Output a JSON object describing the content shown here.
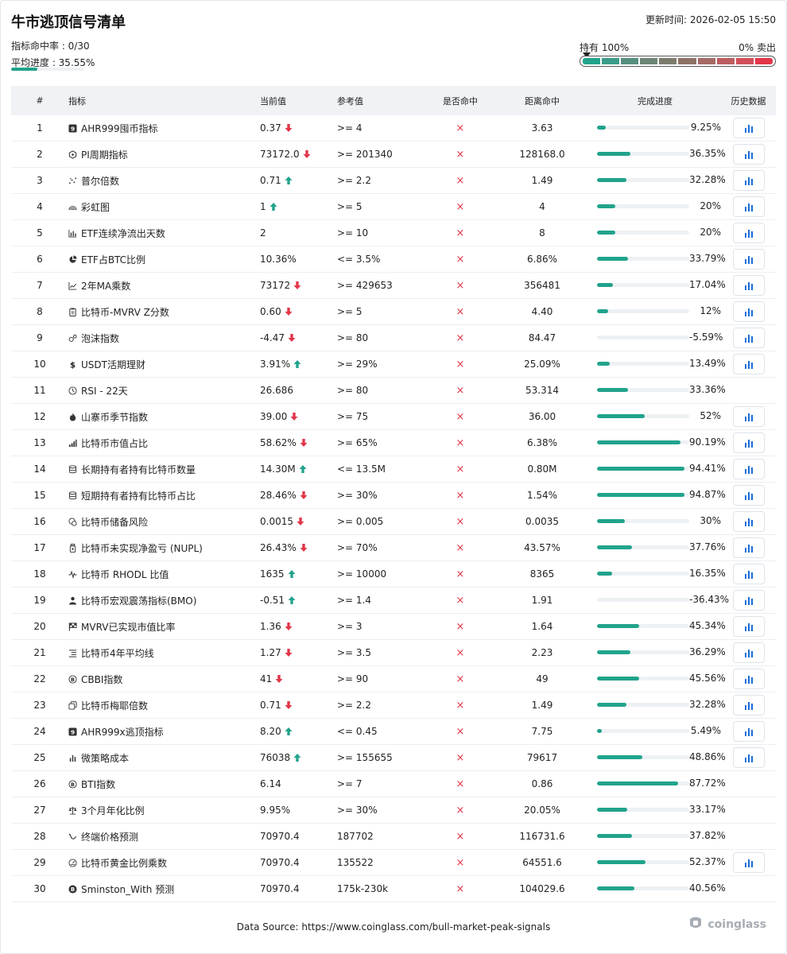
{
  "header": {
    "title": "牛市逃顶信号清单",
    "updated": "更新时间: 2026-02-05 15:50",
    "hit_rate": "指标命中率 : 0/30",
    "avg_progress_label": "平均进度 : 35.55%",
    "avg_progress_value": 35.55
  },
  "scale": {
    "left_label": "持有 100%",
    "right_label": "0% 卖出",
    "segments": [
      "#21a38c",
      "#3b9c8a",
      "#568f80",
      "#6b8576",
      "#7d7b6d",
      "#8f7266",
      "#a56a65",
      "#bb5d60",
      "#d24f5a",
      "#e2364a"
    ]
  },
  "colors": {
    "accent": "#21a38c",
    "down": "#e2364a",
    "up": "#21a38c",
    "chart_btn": "#1a6ed8"
  },
  "columns": {
    "idx": "#",
    "name": "指标",
    "current": "当前值",
    "reference": "参考值",
    "hit": "是否命中",
    "distance": "距离命中",
    "progress": "完成进度",
    "history": "历史数据"
  },
  "hit_symbol": "×",
  "rows": [
    {
      "idx": "1",
      "icon": "nine-badge-icon",
      "name": "AHR999囤币指标",
      "current": "0.37",
      "trend": "down",
      "reference": ">= 4",
      "distance": "3.63",
      "progress": 9.25,
      "progress_label": "9.25%",
      "history": true
    },
    {
      "idx": "2",
      "icon": "pi-cycle-icon",
      "name": "PI周期指标",
      "current": "73172.0",
      "trend": "down",
      "reference": ">= 201340",
      "distance": "128168.0",
      "progress": 36.35,
      "progress_label": "36.35%",
      "history": true
    },
    {
      "idx": "3",
      "icon": "scatter-icon",
      "name": "普尔倍数",
      "current": "0.71",
      "trend": "up",
      "reference": ">= 2.2",
      "distance": "1.49",
      "progress": 32.28,
      "progress_label": "32.28%",
      "history": true
    },
    {
      "idx": "4",
      "icon": "rainbow-icon",
      "name": "彩虹图",
      "current": "1",
      "trend": "up",
      "reference": ">= 5",
      "distance": "4",
      "progress": 20,
      "progress_label": "20%",
      "history": true
    },
    {
      "idx": "5",
      "icon": "bar-chart-icon",
      "name": "ETF连续净流出天数",
      "current": "2",
      "trend": "",
      "reference": ">= 10",
      "distance": "8",
      "progress": 20,
      "progress_label": "20%",
      "history": true
    },
    {
      "idx": "6",
      "icon": "pie-chart-icon",
      "name": "ETF占BTC比例",
      "current": "10.36%",
      "trend": "",
      "reference": "<= 3.5%",
      "distance": "6.86%",
      "progress": 33.79,
      "progress_label": "33.79%",
      "history": true
    },
    {
      "idx": "7",
      "icon": "line-chart-icon",
      "name": "2年MA乘数",
      "current": "73172",
      "trend": "down",
      "reference": ">= 429653",
      "distance": "356481",
      "progress": 17.04,
      "progress_label": "17.04%",
      "history": true
    },
    {
      "idx": "8",
      "icon": "clipboard-icon",
      "name": "比特币-MVRV Z分数",
      "current": "0.60",
      "trend": "down",
      "reference": ">= 5",
      "distance": "4.40",
      "progress": 12,
      "progress_label": "12%",
      "history": true
    },
    {
      "idx": "9",
      "icon": "bubbles-icon",
      "name": "泡沫指数",
      "current": "-4.47",
      "trend": "down",
      "reference": ">= 80",
      "distance": "84.47",
      "progress": 0,
      "progress_label": "-5.59%",
      "history": true
    },
    {
      "idx": "10",
      "icon": "dollar-icon",
      "name": "USDT活期理财",
      "current": "3.91%",
      "trend": "up",
      "reference": ">= 29%",
      "distance": "25.09%",
      "progress": 13.49,
      "progress_label": "13.49%",
      "history": true
    },
    {
      "idx": "11",
      "icon": "clock-icon",
      "name": "RSI - 22天",
      "current": "26.686",
      "trend": "",
      "reference": ">= 80",
      "distance": "53.314",
      "progress": 33.36,
      "progress_label": "33.36%",
      "history": false
    },
    {
      "idx": "12",
      "icon": "fire-icon",
      "name": "山寨币季节指数",
      "current": "39.00",
      "trend": "down",
      "reference": ">= 75",
      "distance": "36.00",
      "progress": 52,
      "progress_label": "52%",
      "history": true
    },
    {
      "idx": "13",
      "icon": "signal-bars-icon",
      "name": "比特币市值占比",
      "current": "58.62%",
      "trend": "down",
      "reference": ">= 65%",
      "distance": "6.38%",
      "progress": 90.19,
      "progress_label": "90.19%",
      "history": true
    },
    {
      "idx": "14",
      "icon": "database-icon",
      "name": "长期持有者持有比特币数量",
      "current": "14.30M",
      "trend": "up",
      "reference": "<= 13.5M",
      "distance": "0.80M",
      "progress": 94.41,
      "progress_label": "94.41%",
      "history": true
    },
    {
      "idx": "15",
      "icon": "database-icon",
      "name": "短期持有者持有比特币占比",
      "current": "28.46%",
      "trend": "down",
      "reference": ">= 30%",
      "distance": "1.54%",
      "progress": 94.87,
      "progress_label": "94.87%",
      "history": true
    },
    {
      "idx": "16",
      "icon": "reserve-icon",
      "name": "比特币储备风险",
      "current": "0.0015",
      "trend": "down",
      "reference": ">= 0.005",
      "distance": "0.0035",
      "progress": 30,
      "progress_label": "30%",
      "history": true
    },
    {
      "idx": "17",
      "icon": "jar-icon",
      "name": "比特币未实现净盈亏 (NUPL)",
      "current": "26.43%",
      "trend": "down",
      "reference": ">= 70%",
      "distance": "43.57%",
      "progress": 37.76,
      "progress_label": "37.76%",
      "history": true
    },
    {
      "idx": "18",
      "icon": "pulse-icon",
      "name": "比特币 RHODL 比值",
      "current": "1635",
      "trend": "up",
      "reference": ">= 10000",
      "distance": "8365",
      "progress": 16.35,
      "progress_label": "16.35%",
      "history": true
    },
    {
      "idx": "19",
      "icon": "person-icon",
      "name": "比特币宏观震荡指标(BMO)",
      "current": "-0.51",
      "trend": "up",
      "reference": ">= 1.4",
      "distance": "1.91",
      "progress": 0,
      "progress_label": "-36.43%",
      "history": true
    },
    {
      "idx": "20",
      "icon": "flag-icon",
      "name": "MVRV已实现市值比率",
      "current": "1.36",
      "trend": "down",
      "reference": ">= 3",
      "distance": "1.64",
      "progress": 45.34,
      "progress_label": "45.34%",
      "history": true
    },
    {
      "idx": "21",
      "icon": "list-icon",
      "name": "比特币4年平均线",
      "current": "1.27",
      "trend": "down",
      "reference": ">= 3.5",
      "distance": "2.23",
      "progress": 36.29,
      "progress_label": "36.29%",
      "history": true
    },
    {
      "idx": "22",
      "icon": "bitcoin-outline-icon",
      "name": "CBBI指数",
      "current": "41",
      "trend": "down",
      "reference": ">= 90",
      "distance": "49",
      "progress": 45.56,
      "progress_label": "45.56%",
      "history": true
    },
    {
      "idx": "23",
      "icon": "copy-icon",
      "name": "比特币梅耶倍数",
      "current": "0.71",
      "trend": "down",
      "reference": ">= 2.2",
      "distance": "1.49",
      "progress": 32.28,
      "progress_label": "32.28%",
      "history": true
    },
    {
      "idx": "24",
      "icon": "nine-badge-icon",
      "name": "AHR999x逃顶指标",
      "current": "8.20",
      "trend": "up",
      "reference": "<= 0.45",
      "distance": "7.75",
      "progress": 5.49,
      "progress_label": "5.49%",
      "history": true
    },
    {
      "idx": "25",
      "icon": "small-bars-icon",
      "name": "微策略成本",
      "current": "76038",
      "trend": "up",
      "reference": ">= 155655",
      "distance": "79617",
      "progress": 48.86,
      "progress_label": "48.86%",
      "history": true
    },
    {
      "idx": "26",
      "icon": "bitcoin-outline-icon",
      "name": "BTI指数",
      "current": "6.14",
      "trend": "",
      "reference": ">= 7",
      "distance": "0.86",
      "progress": 87.72,
      "progress_label": "87.72%",
      "history": false
    },
    {
      "idx": "27",
      "icon": "scales-icon",
      "name": "3个月年化比例",
      "current": "9.95%",
      "trend": "",
      "reference": ">= 30%",
      "distance": "20.05%",
      "progress": 33.17,
      "progress_label": "33.17%",
      "history": false
    },
    {
      "idx": "28",
      "icon": "trend-curve-icon",
      "name": "终端价格预测",
      "current": "70970.4",
      "trend": "",
      "reference": "187702",
      "distance": "116731.6",
      "progress": 37.82,
      "progress_label": "37.82%",
      "history": false
    },
    {
      "idx": "29",
      "icon": "gauge-icon",
      "name": "比特币黄金比例乘数",
      "current": "70970.4",
      "trend": "",
      "reference": "135522",
      "distance": "64551.6",
      "progress": 52.37,
      "progress_label": "52.37%",
      "history": true
    },
    {
      "idx": "30",
      "icon": "bitcoin-filled-icon",
      "name": "Sminston_With 预测",
      "current": "70970.4",
      "trend": "",
      "reference": "175k-230k",
      "distance": "104029.6",
      "progress": 40.56,
      "progress_label": "40.56%",
      "history": false
    }
  ],
  "footer": {
    "source": "Data Source: https://www.coinglass.com/bull-market-peak-signals",
    "brand": "coinglass"
  }
}
